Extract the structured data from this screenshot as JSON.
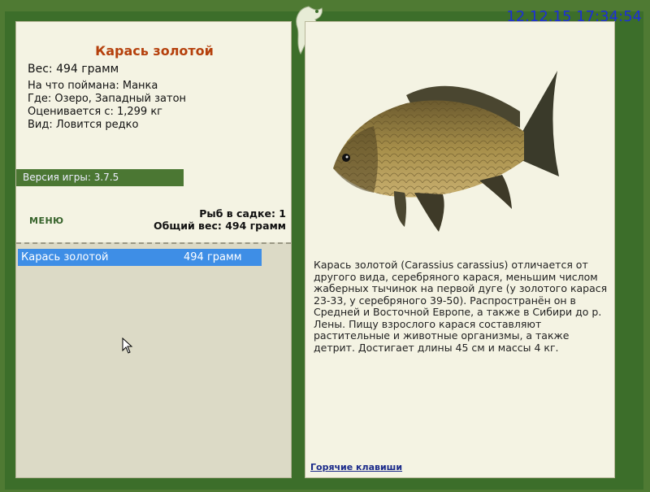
{
  "clock": "12.12.15 17:34:54",
  "fish": {
    "name": "Карась золотой",
    "weight_line": "Вес: 494 грамм",
    "bait_line": "На что поймана: Манка",
    "place_line": "Где: Озеро, Западный затон",
    "value_line": "Оценивается с: 1,299 кг",
    "kind_line": "Вид: Ловится редко"
  },
  "version_label": "Версия игры: 3.7.5",
  "menu_label": "МЕНЮ",
  "stats": {
    "count_line": "Рыб в садке: 1",
    "total_line": "Общий вес: 494 грамм"
  },
  "catch_list": [
    {
      "name": "Карась золотой",
      "weight": "494 грамм"
    }
  ],
  "description": "Карась золотой (Carassius carassius) отличается от другого вида, серебряного карася, меньшим числом жаберных тычинок на первой дуге (у золотого карася 23-33, у серебряного 39-50). Распространён он в Средней и Восточной Европе, а также в Сибири до р. Лены. Пищу взрослого карася составляют растительные и животные организмы, а также детрит. Достигает длины 45 см и массы 4 кг.",
  "hotkeys_label": "Горячие клавиши",
  "colors": {
    "frame_green": "#3c6e2a",
    "panel_bg": "#f4f3e3",
    "title_orange": "#b5400c",
    "selection_blue": "#3e8ee6",
    "clock_blue": "#1d2fd8"
  }
}
